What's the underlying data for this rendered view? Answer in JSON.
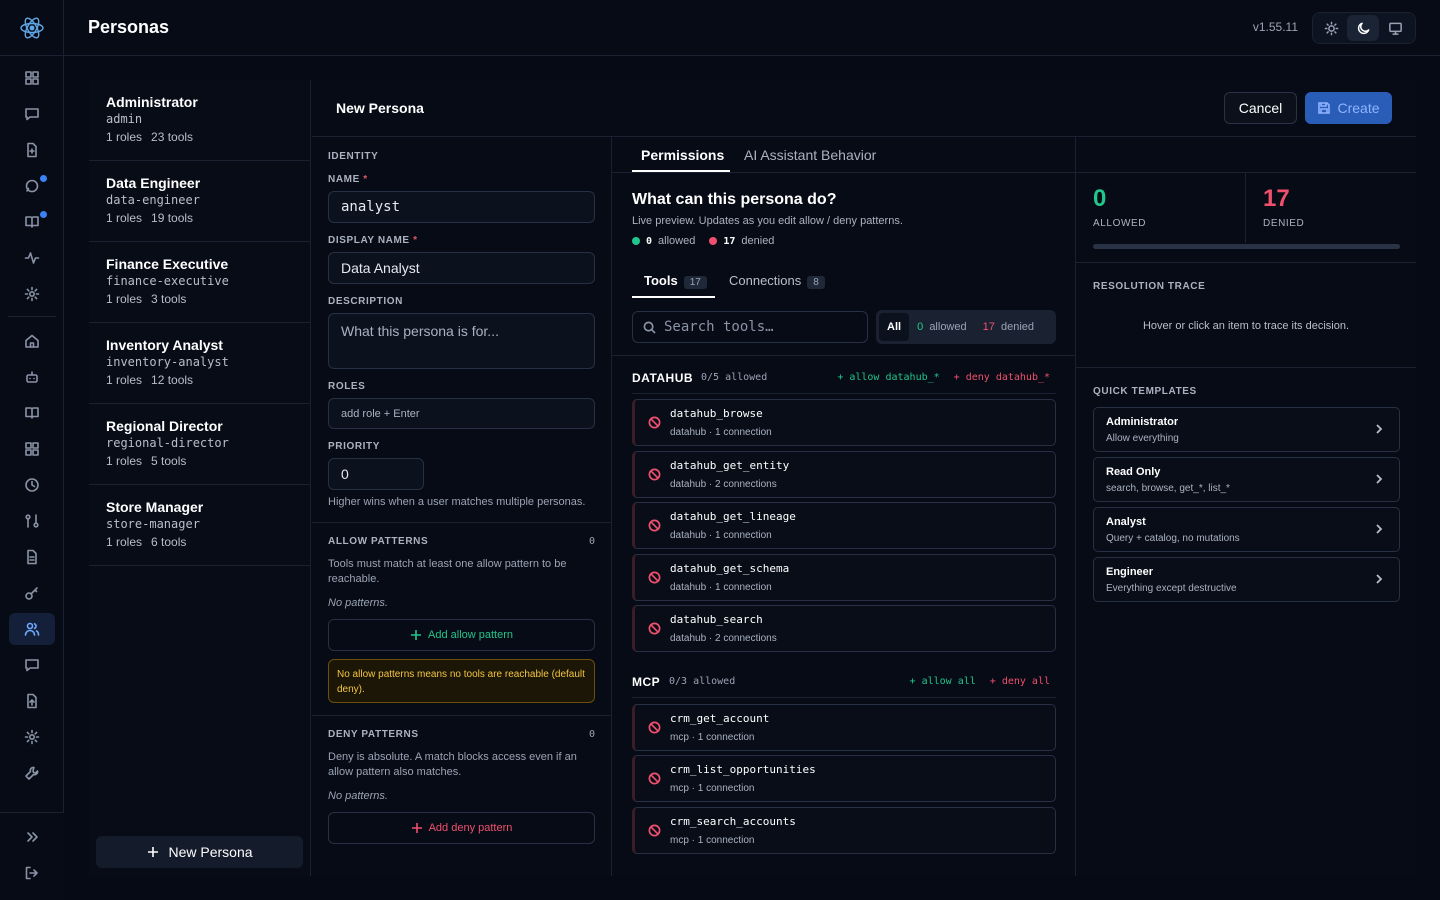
{
  "app": {
    "title": "Personas",
    "version": "v1.55.11"
  },
  "personas": [
    {
      "name": "Administrator",
      "slug": "admin",
      "roles": "1 roles",
      "tools": "23 tools"
    },
    {
      "name": "Data Engineer",
      "slug": "data-engineer",
      "roles": "1 roles",
      "tools": "19 tools"
    },
    {
      "name": "Finance Executive",
      "slug": "finance-executive",
      "roles": "1 roles",
      "tools": "3 tools"
    },
    {
      "name": "Inventory Analyst",
      "slug": "inventory-analyst",
      "roles": "1 roles",
      "tools": "12 tools"
    },
    {
      "name": "Regional Director",
      "slug": "regional-director",
      "roles": "1 roles",
      "tools": "5 tools"
    },
    {
      "name": "Store Manager",
      "slug": "store-manager",
      "roles": "1 roles",
      "tools": "6 tools"
    }
  ],
  "new_persona_label": "New Persona",
  "editor": {
    "title": "New Persona",
    "cancel": "Cancel",
    "create": "Create"
  },
  "form": {
    "identity_heading": "IDENTITY",
    "name_label": "NAME",
    "name_value": "analyst",
    "display_name_label": "DISPLAY NAME",
    "display_name_value": "Data Analyst",
    "description_label": "DESCRIPTION",
    "description_placeholder": "What this persona is for...",
    "roles_label": "ROLES",
    "roles_placeholder": "add role + Enter",
    "priority_label": "PRIORITY",
    "priority_value": "0",
    "priority_hint": "Higher wins when a user matches multiple personas.",
    "allow_heading": "ALLOW PATTERNS",
    "allow_count": "0",
    "allow_hint": "Tools must match at least one allow pattern to be reachable.",
    "allow_empty": "No patterns.",
    "allow_add": "Add allow pattern",
    "allow_warning": "No allow patterns means no tools are reachable (default deny).",
    "deny_heading": "DENY PATTERNS",
    "deny_count": "0",
    "deny_hint": "Deny is absolute. A match blocks access even if an allow pattern also matches.",
    "deny_empty": "No patterns.",
    "deny_add": "Add deny pattern",
    "required_mark": "*"
  },
  "tabs": [
    "Permissions",
    "AI Assistant Behavior"
  ],
  "perm": {
    "heading": "What can this persona do?",
    "subheading": "Live preview. Updates as you edit allow / deny patterns.",
    "allowed_n": "0",
    "allowed_word": "allowed",
    "denied_n": "17",
    "denied_word": "denied",
    "subtabs": [
      {
        "label": "Tools",
        "count": "17"
      },
      {
        "label": "Connections",
        "count": "8"
      }
    ],
    "search_placeholder": "Search tools…",
    "filter_all": "All",
    "filter_allowed_n": "0",
    "filter_allowed": "allowed",
    "filter_denied_n": "17",
    "filter_denied": "denied"
  },
  "groups": [
    {
      "name": "DATAHUB",
      "count": "0/5 allowed",
      "allow": "+ allow datahub_*",
      "deny": "+ deny datahub_*",
      "tools": [
        {
          "name": "datahub_browse",
          "meta": "datahub  ·  1 connection"
        },
        {
          "name": "datahub_get_entity",
          "meta": "datahub  ·  2 connections"
        },
        {
          "name": "datahub_get_lineage",
          "meta": "datahub  ·  1 connection"
        },
        {
          "name": "datahub_get_schema",
          "meta": "datahub  ·  1 connection"
        },
        {
          "name": "datahub_search",
          "meta": "datahub  ·  2 connections"
        }
      ]
    },
    {
      "name": "MCP",
      "count": "0/3 allowed",
      "allow": "+ allow all",
      "deny": "+ deny all",
      "tools": [
        {
          "name": "crm_get_account",
          "meta": "mcp  ·  1 connection"
        },
        {
          "name": "crm_list_opportunities",
          "meta": "mcp  ·  1 connection"
        },
        {
          "name": "crm_search_accounts",
          "meta": "mcp  ·  1 connection"
        }
      ]
    }
  ],
  "stats": {
    "allowed": "0",
    "allowed_label": "ALLOWED",
    "denied": "17",
    "denied_label": "DENIED"
  },
  "trace": {
    "heading": "RESOLUTION TRACE",
    "hint": "Hover or click an item to trace its decision."
  },
  "templates": {
    "heading": "QUICK TEMPLATES",
    "items": [
      {
        "name": "Administrator",
        "desc": "Allow everything"
      },
      {
        "name": "Read Only",
        "desc": "search, browse, get_*, list_*"
      },
      {
        "name": "Analyst",
        "desc": "Query + catalog, no mutations"
      },
      {
        "name": "Engineer",
        "desc": "Everything except destructive"
      }
    ]
  },
  "colors": {
    "accent": "#3b82f6",
    "allowed": "#22c58b",
    "denied": "#f0506e",
    "warning": "#f4c542"
  }
}
